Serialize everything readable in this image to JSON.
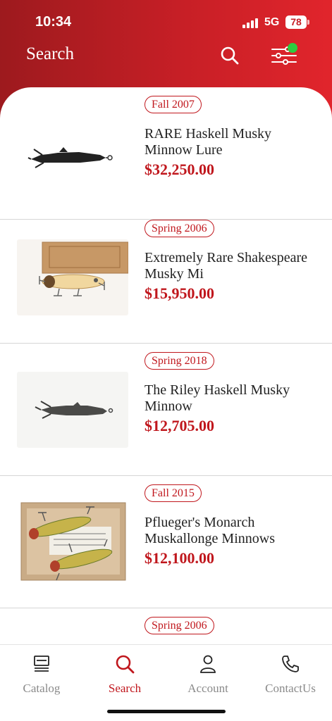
{
  "status": {
    "time": "10:34",
    "network": "5G",
    "battery": "78"
  },
  "header": {
    "title": "Search",
    "search_icon": "search-icon",
    "filter_icon": "sliders-icon"
  },
  "results": [
    {
      "season": "Fall 2007",
      "title": "RARE Haskell Musky Minnow Lure",
      "price": "$32,250.00"
    },
    {
      "season": "Spring 2006",
      "title": "Extremely Rare Shakespeare Musky Mi",
      "price": "$15,950.00"
    },
    {
      "season": "Spring 2018",
      "title": "The Riley Haskell Musky Minnow",
      "price": "$12,705.00"
    },
    {
      "season": "Fall 2015",
      "title": "Pflueger's Monarch Muskallonge Minnows",
      "price": "$12,100.00"
    },
    {
      "season": "Spring 2006"
    }
  ],
  "tabs": [
    {
      "label": "Catalog",
      "icon": "catalog-icon"
    },
    {
      "label": "Search",
      "icon": "search-icon",
      "active": true
    },
    {
      "label": "Account",
      "icon": "person-icon"
    },
    {
      "label": "ContactUs",
      "icon": "phone-icon"
    }
  ],
  "colors": {
    "brand_red": "#c0171d",
    "filter_dot": "#2ecc40"
  }
}
